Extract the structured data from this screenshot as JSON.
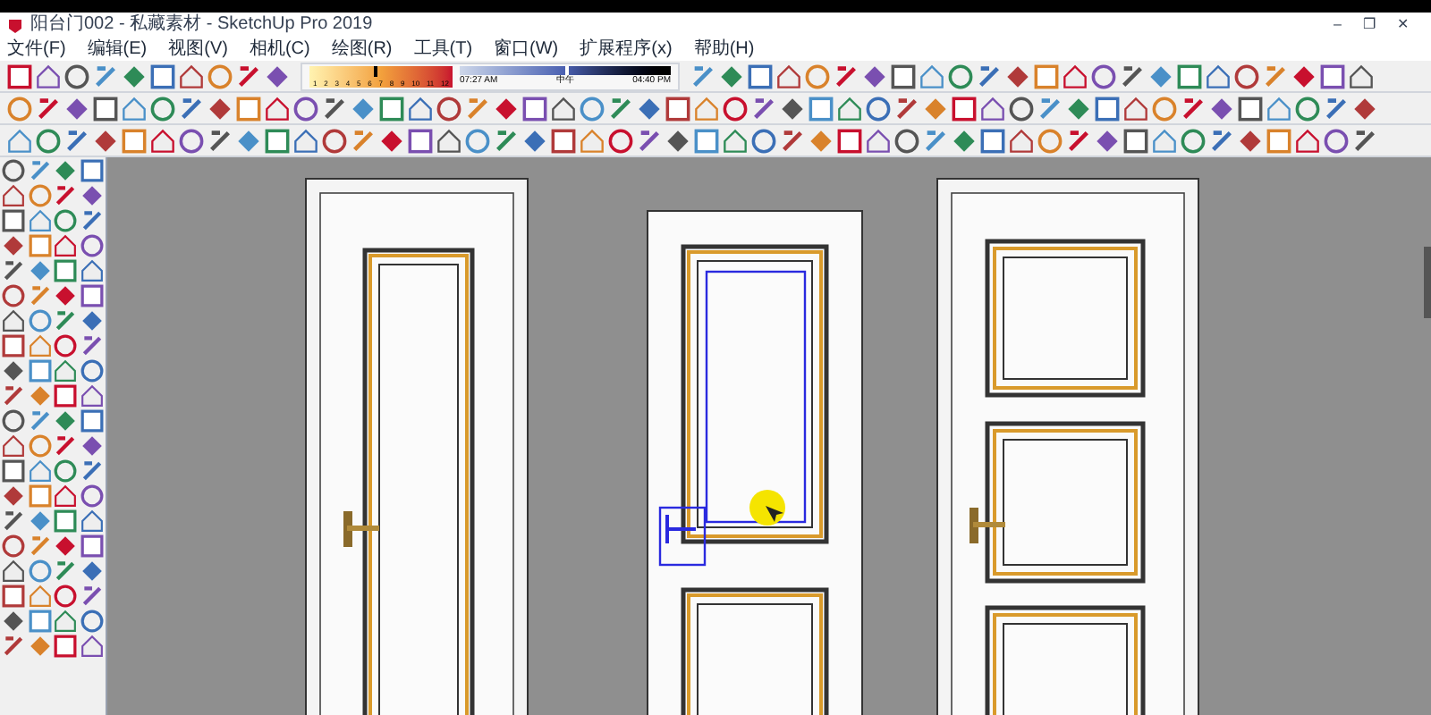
{
  "window": {
    "title": "阳台门002 - 私藏素材 - SketchUp Pro 2019",
    "controls": [
      "–",
      "❐",
      "✕"
    ]
  },
  "menu": [
    "文件(F)",
    "编辑(E)",
    "视图(V)",
    "相机(C)",
    "绘图(R)",
    "工具(T)",
    "窗口(W)",
    "扩展程序(x)",
    "帮助(H)"
  ],
  "shadow_settings": {
    "date_slider": {
      "level": 0.45
    },
    "time_slider": {
      "level": 0.5
    },
    "months": [
      "1",
      "2",
      "3",
      "4",
      "5",
      "6",
      "7",
      "8",
      "9",
      "10",
      "11",
      "12"
    ],
    "time_start": "07:27 AM",
    "time_middle": "中午",
    "time_end": "04:40 PM"
  }
}
